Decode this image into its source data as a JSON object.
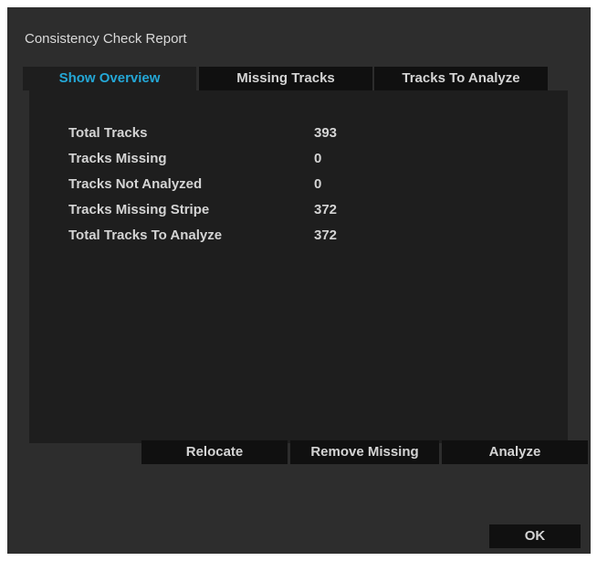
{
  "dialog": {
    "title": "Consistency Check Report"
  },
  "tabs": [
    {
      "label": "Show Overview",
      "active": true
    },
    {
      "label": "Missing Tracks",
      "active": false
    },
    {
      "label": "Tracks To Analyze",
      "active": false
    }
  ],
  "overview": {
    "rows": [
      {
        "label": "Total Tracks",
        "value": "393"
      },
      {
        "label": "Tracks Missing",
        "value": "0"
      },
      {
        "label": "Tracks Not Analyzed",
        "value": "0"
      },
      {
        "label": "Tracks Missing Stripe",
        "value": "372"
      },
      {
        "label": "Total Tracks To Analyze",
        "value": "372"
      }
    ]
  },
  "actions": {
    "relocate": "Relocate",
    "remove_missing": "Remove Missing",
    "analyze": "Analyze"
  },
  "footer": {
    "ok": "OK"
  },
  "colors": {
    "accent": "#24a7d6",
    "background": "#2d2d2d",
    "panel": "#1e1e1e",
    "button": "#101010"
  }
}
